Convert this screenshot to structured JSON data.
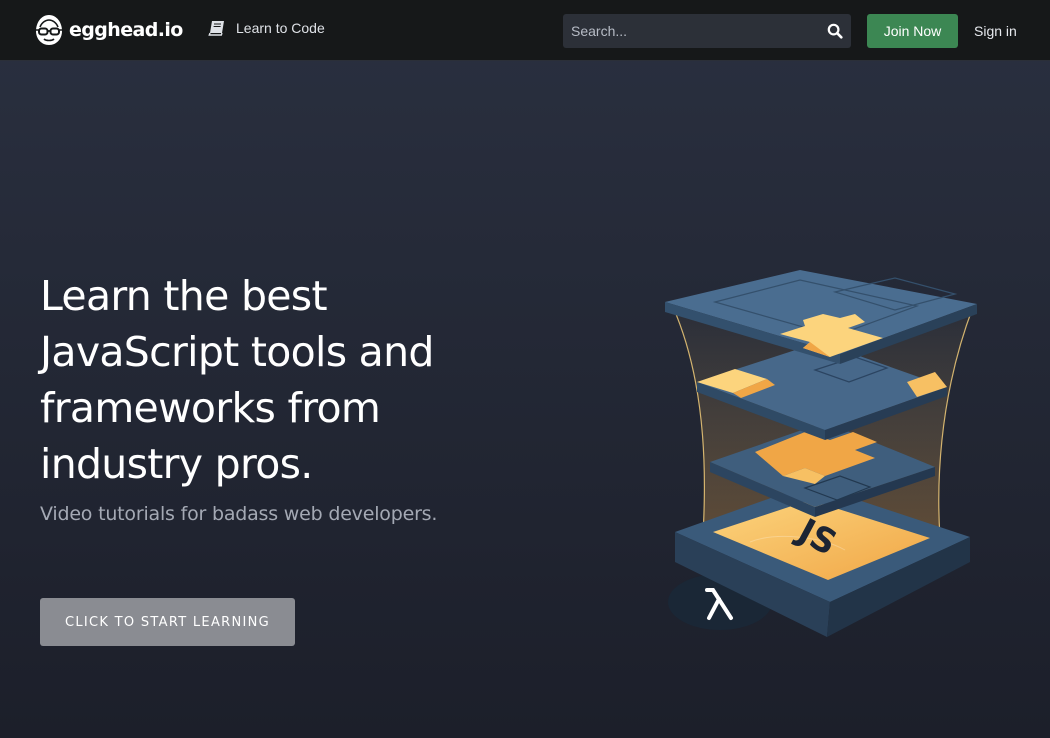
{
  "header": {
    "logo_text": "egghead.io",
    "learn_link": "Learn to Code",
    "search_placeholder": "Search...",
    "join_label": "Join Now",
    "signin_label": "Sign in"
  },
  "hero": {
    "title_lines": [
      "Learn the best",
      "JavaScript tools and",
      "frameworks from",
      "industry pros."
    ],
    "subtitle": "Video tutorials for badass web developers.",
    "cta_label": "CLICK TO START LEARNING",
    "illustration_text": "JS"
  },
  "colors": {
    "header_bg": "#161819",
    "hero_bg": "#232837",
    "join_button": "#3c8753",
    "cta_button": "#8a8c92",
    "accent_orange": "#f0a646",
    "accent_yellow": "#fcd47d"
  },
  "icons": {
    "logo": "egghead-logo-icon",
    "learn": "book-icon",
    "search": "search-icon",
    "lambda": "lambda-icon"
  }
}
